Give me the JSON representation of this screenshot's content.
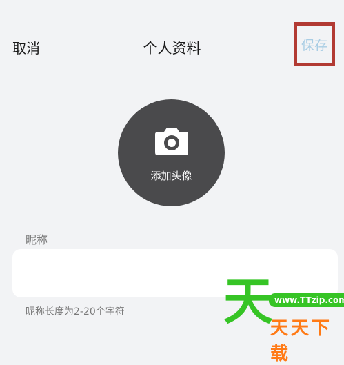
{
  "header": {
    "cancel_label": "取消",
    "title": "个人资料",
    "save_label": "保存"
  },
  "avatar": {
    "icon": "camera-icon",
    "label": "添加头像"
  },
  "nickname": {
    "label": "昵称",
    "value": "",
    "hint": "昵称长度为2-20个字符"
  },
  "watermark": {
    "glyph": "天",
    "url": "www.TTzip.com",
    "name": "天天下载"
  },
  "colors": {
    "background": "#f2f3f5",
    "highlight_box": "#b23a33",
    "save_text": "#a9cde4",
    "avatar_bg": "#4a4a4c"
  }
}
